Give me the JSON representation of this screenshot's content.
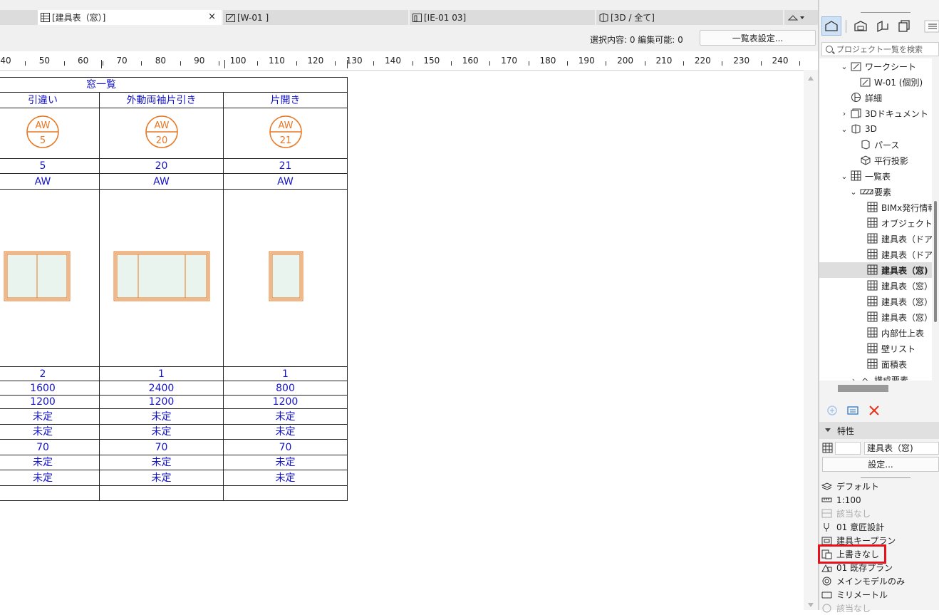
{
  "tabs": [
    {
      "label": "[建具表（窓）]",
      "icon": "schedule-grid-icon",
      "active": true
    },
    {
      "label": "[W-01 ]",
      "icon": "worksheet-icon",
      "active": false
    },
    {
      "label": "[IE-01 03]",
      "icon": "interior-elevation-icon",
      "active": false
    },
    {
      "label": "[3D / 全て]",
      "icon": "3d-box-icon",
      "active": false
    }
  ],
  "close_glyph": "×",
  "info": {
    "selection": "選択内容: 0  編集可能: 0",
    "settings_button": "一覧表設定..."
  },
  "ruler_labels": [
    "40",
    "50",
    "60",
    "70",
    "80",
    "90",
    "100",
    "110",
    "120",
    "130",
    "140",
    "150",
    "160",
    "170",
    "180",
    "190",
    "200",
    "210",
    "220",
    "230",
    "240"
  ],
  "schedule": {
    "title": "窓一覧",
    "types": [
      "引違い",
      "外動両袖片引き",
      "片開き"
    ],
    "markers": [
      {
        "top": "AW",
        "bottom": "5"
      },
      {
        "top": "AW",
        "bottom": "20"
      },
      {
        "top": "AW",
        "bottom": "21"
      }
    ],
    "numbers": [
      "5",
      "20",
      "21"
    ],
    "codes": [
      "AW",
      "AW",
      "AW"
    ],
    "rows": [
      [
        "2",
        "1",
        "1"
      ],
      [
        "1600",
        "2400",
        "800"
      ],
      [
        "1200",
        "1200",
        "1200"
      ],
      [
        "未定",
        "未定",
        "未定"
      ],
      [
        "未定",
        "未定",
        "未定"
      ],
      [
        "70",
        "70",
        "70"
      ],
      [
        "未定",
        "未定",
        "未定"
      ],
      [
        "未定",
        "未定",
        "未定"
      ],
      [
        "",
        "",
        ""
      ]
    ]
  },
  "navigator": {
    "search_placeholder": "プロジェクト一覧を検索",
    "tree": [
      {
        "label": "ワークシート",
        "chevron": "v",
        "icon": "worksheet-icon",
        "indent": 1
      },
      {
        "label": "W-01 (個別)",
        "chevron": "",
        "icon": "worksheet-icon",
        "indent": 2
      },
      {
        "label": "詳細",
        "chevron": "",
        "icon": "detail-icon",
        "indent": 1
      },
      {
        "label": "3Dドキュメント",
        "chevron": ">",
        "icon": "3d-document-icon",
        "indent": 1
      },
      {
        "label": "3D",
        "chevron": "v",
        "icon": "3d-box-icon",
        "indent": 1
      },
      {
        "label": "パース",
        "chevron": "",
        "icon": "perspective-icon",
        "indent": 2
      },
      {
        "label": "平行投影",
        "chevron": "",
        "icon": "axonometric-icon",
        "indent": 2
      },
      {
        "label": "一覧表",
        "chevron": "v",
        "icon": "schedule-grid-icon",
        "indent": 1
      },
      {
        "label": "要素",
        "chevron": "v",
        "icon": "element-hatch-icon",
        "indent": 2
      },
      {
        "label": "BIMx発行情報",
        "chevron": "",
        "icon": "schedule-grid-icon",
        "indent": 3
      },
      {
        "label": "オブジェクトリスト",
        "chevron": "",
        "icon": "schedule-grid-icon",
        "indent": 3
      },
      {
        "label": "建具表（ドア)",
        "chevron": "",
        "icon": "schedule-grid-icon",
        "indent": 3
      },
      {
        "label": "建具表（ドア）_",
        "chevron": "",
        "icon": "schedule-grid-icon",
        "indent": 3
      },
      {
        "label": "建具表（窓)",
        "chevron": "",
        "icon": "schedule-grid-icon",
        "indent": 3,
        "selected": true
      },
      {
        "label": "建具表（窓）コ",
        "chevron": "",
        "icon": "schedule-grid-icon",
        "indent": 3
      },
      {
        "label": "建具表（窓）コ",
        "chevron": "",
        "icon": "schedule-grid-icon",
        "indent": 3
      },
      {
        "label": "建具表（窓）_札",
        "chevron": "",
        "icon": "schedule-grid-icon",
        "indent": 3
      },
      {
        "label": "内部仕上表",
        "chevron": "",
        "icon": "schedule-grid-icon",
        "indent": 3
      },
      {
        "label": "壁リスト",
        "chevron": "",
        "icon": "schedule-grid-icon",
        "indent": 3
      },
      {
        "label": "面積表",
        "chevron": "",
        "icon": "schedule-grid-icon",
        "indent": 3
      },
      {
        "label": "構成要素",
        "chevron": ">",
        "icon": "component-icon",
        "indent": 2
      }
    ]
  },
  "properties": {
    "header": "特性",
    "name": "建具表（窓)",
    "settings_button": "設定...",
    "settings": [
      {
        "label": "デフォルト",
        "icon": "layers-icon",
        "dim": false
      },
      {
        "label": "1:100",
        "icon": "scale-ruler-icon",
        "dim": false
      },
      {
        "label": "該当なし",
        "icon": "structure-display-icon",
        "dim": true
      },
      {
        "label": "01 意匠設計",
        "icon": "pen-set-icon",
        "dim": false
      },
      {
        "label": "建具キープラン",
        "icon": "model-view-icon",
        "dim": false
      },
      {
        "label": "上書きなし",
        "icon": "graphic-override-icon",
        "dim": false
      },
      {
        "label": "01 既存プラン",
        "icon": "renovation-filter-icon",
        "dim": false
      },
      {
        "label": "メインモデルのみ",
        "icon": "design-options-icon",
        "dim": false
      },
      {
        "label": "ミリメートル",
        "icon": "dimension-icon",
        "dim": false
      },
      {
        "label": "該当なし",
        "icon": "na-icon",
        "dim": true
      }
    ]
  },
  "colors": {
    "accent_red": "#e8121c",
    "schedule_text": "#1414c8",
    "marker_orange": "#e87722"
  }
}
